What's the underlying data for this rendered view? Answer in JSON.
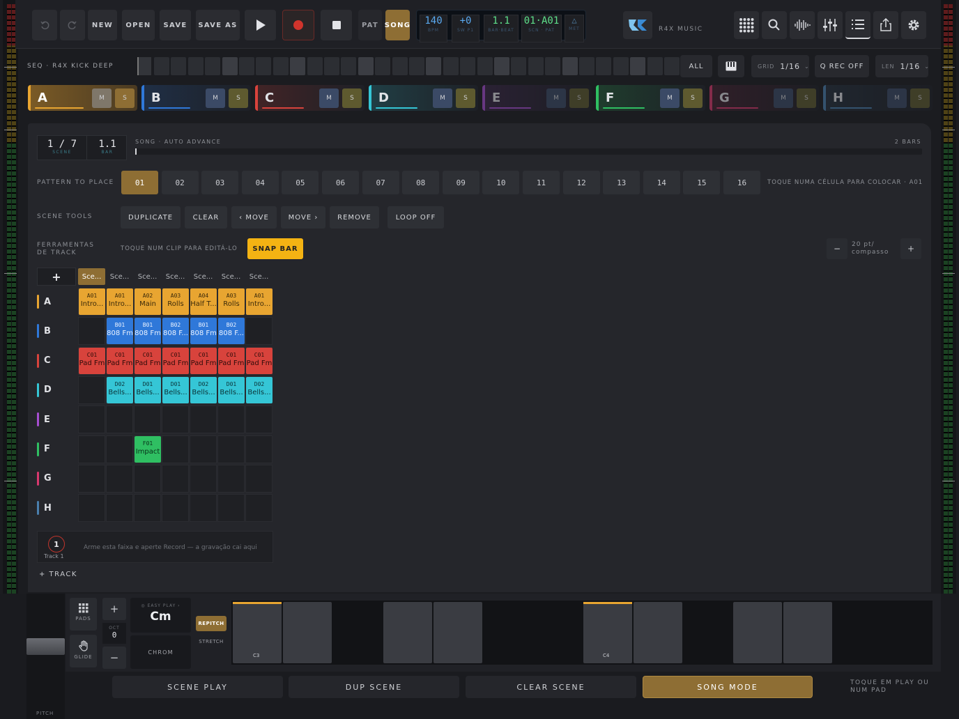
{
  "transport": {
    "new": "NEW",
    "open": "OPEN",
    "save": "SAVE",
    "save_as": "SAVE AS",
    "pat": "PAT",
    "song": "SONG"
  },
  "lcd": {
    "bpm": "140",
    "bpm_label": "BPM",
    "swing": "+0",
    "swing_label": "SW P1",
    "barbeat": "1.1",
    "barbeat_label": "BAR·BEAT",
    "scnpat": "01·A01",
    "scnpat_label": "SCN · PAT",
    "met": "△",
    "met_label": "MET"
  },
  "brand": {
    "name": "R4X MUSIC"
  },
  "seq": {
    "title": "SEQ · R4X KICK DEEP",
    "all": "ALL",
    "grid_label": "GRID",
    "grid_value": "1/16",
    "qrec": "Q REC OFF",
    "len_label": "LEN",
    "len_value": "1/16"
  },
  "tracks": [
    {
      "name": "A",
      "color": "#e8a531"
    },
    {
      "name": "B",
      "color": "#2f78d9"
    },
    {
      "name": "C",
      "color": "#d8433c"
    },
    {
      "name": "D",
      "color": "#35c6d6"
    },
    {
      "name": "E",
      "color": "#a64ed1"
    },
    {
      "name": "F",
      "color": "#2fbf62"
    },
    {
      "name": "G",
      "color": "#d8386e"
    },
    {
      "name": "H",
      "color": "#4a7fae"
    }
  ],
  "mute_label": "M",
  "solo_label": "S",
  "scene_info": {
    "scene": "1 / 7",
    "scene_label": "SCENE",
    "bar": "1.1",
    "bar_label": "BAR",
    "song_label": "SONG · AUTO ADVANCE",
    "bars": "2 BARS"
  },
  "pattern": {
    "label": "PATTERN TO PLACE",
    "items": [
      "01",
      "02",
      "03",
      "04",
      "05",
      "06",
      "07",
      "08",
      "09",
      "10",
      "11",
      "12",
      "13",
      "14",
      "15",
      "16"
    ],
    "hint": "TOQUE NUMA CÉLULA PARA COLOCAR · A01"
  },
  "scene_tools": {
    "label": "SCENE TOOLS",
    "duplicate": "DUPLICATE",
    "clear": "CLEAR",
    "move_left": "‹ MOVE",
    "move_right": "MOVE ›",
    "remove": "REMOVE",
    "loop": "LOOP OFF"
  },
  "track_tools": {
    "label_1": "FERRAMENTAS",
    "label_2": "DE TRACK",
    "hint": "TOQUE NUM CLIP PARA EDITÁ-LO",
    "snap": "SNAP BAR",
    "minus": "−",
    "plus": "+",
    "zoom_1": "20 pt/",
    "zoom_2": "compasso"
  },
  "grid": {
    "add": "+",
    "scenes": [
      "Sce...",
      "Sce...",
      "Sce...",
      "Sce...",
      "Sce...",
      "Sce...",
      "Sce..."
    ],
    "clips": {
      "A": [
        [
          "A01",
          "Intro..."
        ],
        [
          "A01",
          "Intro..."
        ],
        [
          "A02",
          "Main"
        ],
        [
          "A03",
          "Rolls"
        ],
        [
          "A04",
          "Half T..."
        ],
        [
          "A03",
          "Rolls"
        ],
        [
          "A01",
          "Intro..."
        ]
      ],
      "B": [
        null,
        [
          "B01",
          "808 Fm"
        ],
        [
          "B01",
          "808 Fm"
        ],
        [
          "B02",
          "808 F..."
        ],
        [
          "B01",
          "808 Fm"
        ],
        [
          "B02",
          "808 F..."
        ],
        null
      ],
      "C": [
        [
          "C01",
          "Pad Fm"
        ],
        [
          "C01",
          "Pad Fm"
        ],
        [
          "C01",
          "Pad Fm"
        ],
        [
          "C01",
          "Pad Fm"
        ],
        [
          "C01",
          "Pad Fm"
        ],
        [
          "C01",
          "Pad Fm"
        ],
        [
          "C01",
          "Pad Fm"
        ]
      ],
      "D": [
        null,
        [
          "D02",
          "Bells..."
        ],
        [
          "D01",
          "Bells..."
        ],
        [
          "D01",
          "Bells..."
        ],
        [
          "D02",
          "Bells..."
        ],
        [
          "D01",
          "Bells..."
        ],
        [
          "D02",
          "Bells..."
        ]
      ],
      "F": [
        null,
        null,
        [
          "F01",
          "Impact"
        ],
        null,
        null,
        null,
        null
      ]
    }
  },
  "record": {
    "num": "1",
    "label": "Track 1",
    "hint": "Arme esta faixa e aperte Record — a gravação cai aqui",
    "add_track": "+ TRACK"
  },
  "keys": {
    "pads": "PADS",
    "glide": "GLIDE",
    "oct_label": "OCT",
    "oct": "0",
    "easy_play": "◎ EASY PLAY ›",
    "scale": "Cm",
    "chrom": "CHROM",
    "repitch": "REPITCH",
    "stretch": "STRETCH",
    "c3": "C3",
    "c4": "C4",
    "pitch": "PITCH",
    "plus": "+",
    "minus": "−"
  },
  "bottom": {
    "scene_play": "SCENE PLAY",
    "dup_scene": "DUP SCENE",
    "clear_scene": "CLEAR SCENE",
    "song_mode": "SONG MODE",
    "hint_1": "TOQUE EM PLAY OU",
    "hint_2": "NUM PAD"
  },
  "colors": {
    "accent": "#e8a531",
    "selected": "#8e6e34",
    "snap": "#f4b313",
    "record": "#d0342c"
  }
}
